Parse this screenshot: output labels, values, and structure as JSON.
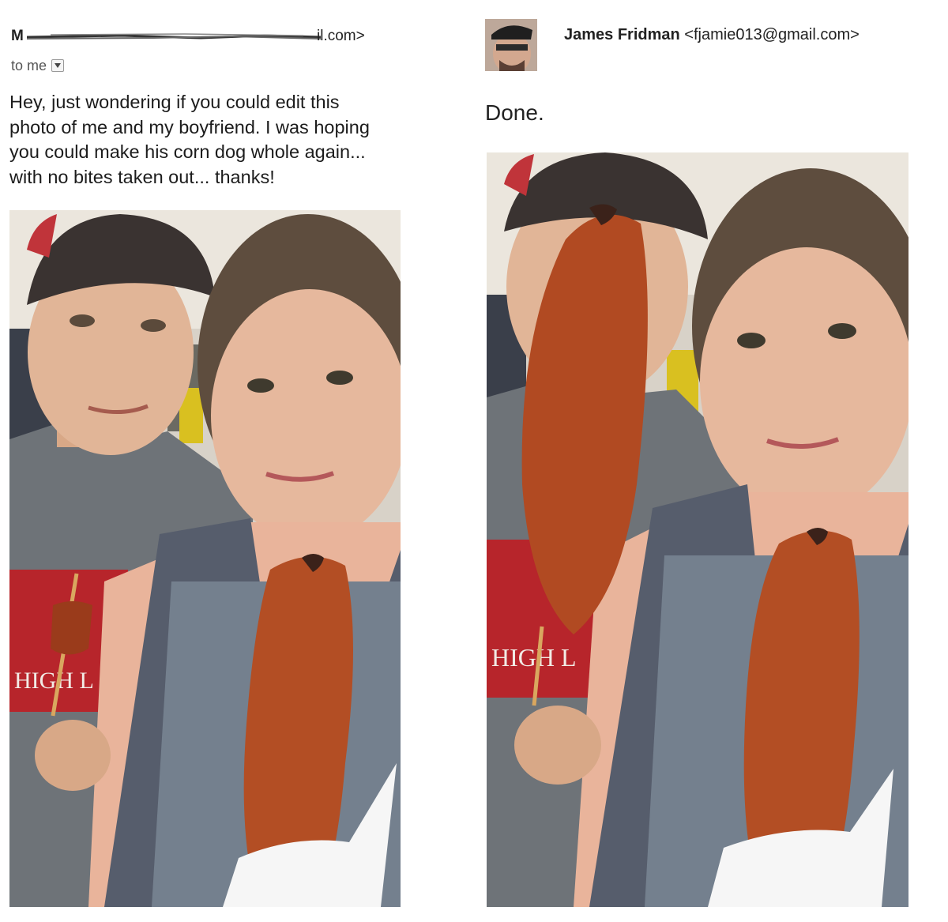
{
  "request_email": {
    "sender_initial": "M",
    "sender_domain": "il.com>",
    "recipient_label": "to me",
    "message_lines": [
      "Hey, just wondering if you could edit this",
      "photo of me and my boyfriend. I was hoping",
      "you could make his corn dog whole again...",
      "with no bites taken out... thanks!"
    ],
    "photo_shirt_text": "HIGH L"
  },
  "reply_email": {
    "sender_name": "James Fridman",
    "sender_email": "<fjamie013@gmail.com>",
    "message": "Done.",
    "photo_shirt_text": "HIGH L"
  },
  "icons": {
    "recipient_dropdown": "chevron-down-icon"
  }
}
